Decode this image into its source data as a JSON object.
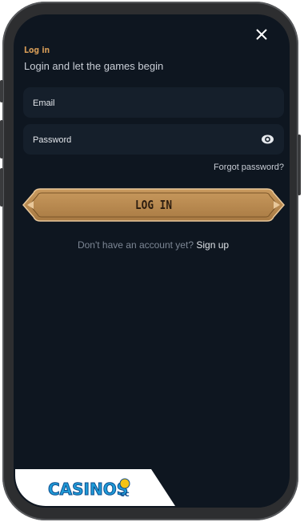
{
  "header": {
    "title": "Log in",
    "subtitle": "Login and let the games begin",
    "close_icon": "close-icon"
  },
  "form": {
    "email_placeholder": "Email",
    "password_placeholder": "Password",
    "password_toggle_icon": "eye-icon",
    "forgot_label": "Forgot password?",
    "submit_label": "LOG IN"
  },
  "signup": {
    "prompt": "Don't have an account yet?",
    "link_label": "Sign up"
  },
  "watermark": {
    "text": "CASINOS.cc"
  },
  "colors": {
    "background": "#0e1620",
    "field": "#151f2b",
    "accent": "#d39a56",
    "button": "#b8894f"
  }
}
